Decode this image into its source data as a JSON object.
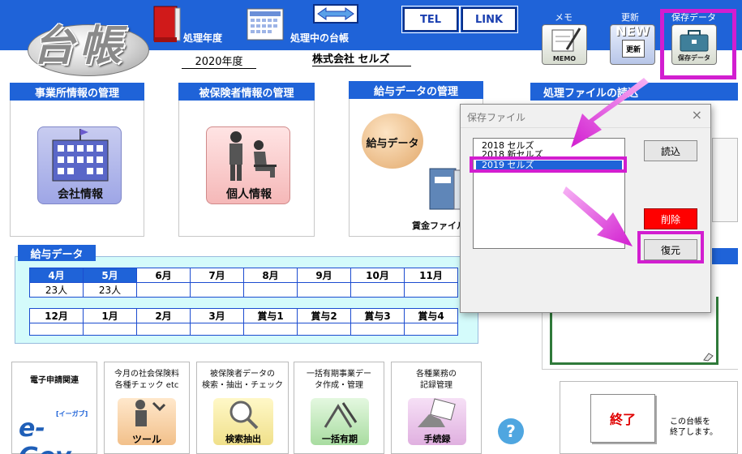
{
  "header": {
    "logo_text": "台帳",
    "processing_year_label": "処理年度",
    "processing_book_label": "処理中の台帳",
    "tel_button": "TEL",
    "link_button": "LINK",
    "memo_label": "メモ",
    "update_label": "更新",
    "save_data_label": "保存データ",
    "memo_icon_caption": "MEMO",
    "update_icon_caption": "更新",
    "update_icon_new": "NEW",
    "save_icon_caption": "保存データ",
    "year_value": "2020年度",
    "company_value": "株式会社 セルズ"
  },
  "sections": {
    "office": "事業所情報の管理",
    "insured": "被保険者情報の管理",
    "salary_mgmt": "給与データの管理",
    "file_load": "処理ファイルの読込"
  },
  "icons": {
    "company_info": "会社情報",
    "personal_info": "個人情報",
    "salary_data": "給与データ",
    "wage_file": "賃金ファイル"
  },
  "salary": {
    "title": "給与データ",
    "row1_headers": [
      "4月",
      "5月",
      "6月",
      "7月",
      "8月",
      "9月",
      "10月",
      "11月"
    ],
    "row1_values": [
      "23人",
      "23人",
      "",
      "",
      "",
      "",
      "",
      ""
    ],
    "row2_headers": [
      "12月",
      "1月",
      "2月",
      "3月",
      "賞与1",
      "賞与2",
      "賞与3",
      "賞与4"
    ],
    "row2_values": [
      "",
      "",
      "",
      "",
      "",
      "",
      "",
      ""
    ]
  },
  "bottom": {
    "egov_top": "電子申請関連",
    "egov_small": "[イーガブ]",
    "egov_logo": "e-Gov",
    "check_text": "今月の社会保険料\n各種チェック etc",
    "check_caption": "ツール",
    "extract_text": "被保険者データの\n検索・抽出・チェック",
    "extract_caption": "検索抽出",
    "bulk_text": "一括有期事業デー\nタ作成・管理",
    "bulk_caption": "一括有期",
    "record_text": "各種業務の\n記録管理",
    "record_caption": "手続録",
    "help": "?",
    "exit_button": "終了",
    "exit_note": "この台帳を\n終了します。"
  },
  "dialog": {
    "title": "保存ファイル",
    "close": "×",
    "items": [
      "2018 セルズ",
      "2018 新セルズ",
      "2019 セルズ"
    ],
    "selected_index": 2,
    "load_button": "読込",
    "delete_button": "削除",
    "restore_button": "復元"
  },
  "colors": {
    "header_blue": "#1f63d8",
    "highlight_magenta": "#d21ed0",
    "delete_red": "#ff0000",
    "salary_bg": "#d4fbfb"
  }
}
